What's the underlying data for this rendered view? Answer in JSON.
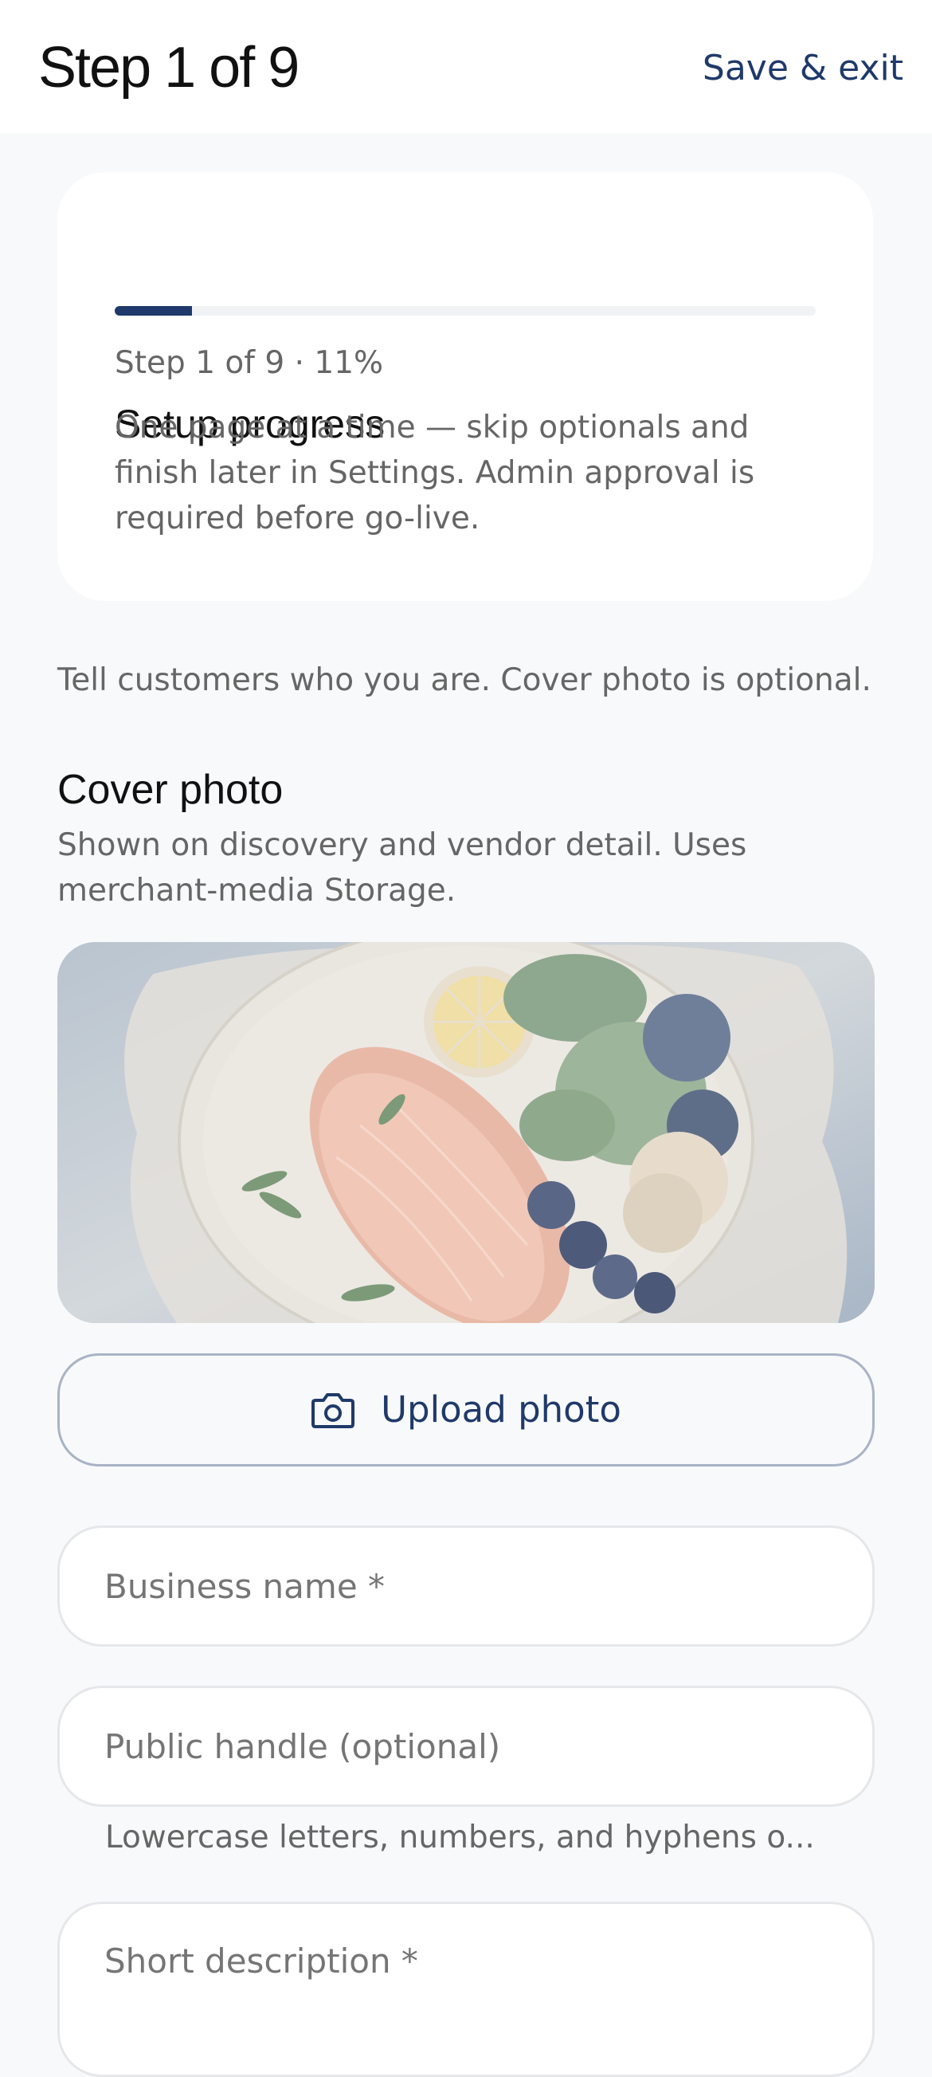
{
  "header": {
    "title": "Step 1 of 9",
    "save_exit_label": "Save & exit"
  },
  "progress": {
    "title": "Setup progress",
    "fraction": 0.11,
    "step_text": "Step 1 of 9 · 11%",
    "description": "One page at a time — skip optionals and finish later in Settings. Admin approval is required before go-live."
  },
  "intro": "Tell customers who you are. Cover photo is optional.",
  "cover_photo": {
    "title": "Cover photo",
    "description": "Shown on discovery and vendor detail. Uses merchant-media Storage.",
    "upload_label": "Upload photo",
    "upload_icon": "camera-icon"
  },
  "fields": {
    "business_name_placeholder": "Business name *",
    "handle_placeholder": "Public handle (optional)",
    "handle_helper": "Lowercase letters, numbers, and hyphens o...",
    "short_description_placeholder": "Short description *"
  },
  "colors": {
    "accent": "#1f3a6a",
    "background": "#f8f9fa",
    "card": "#ffffff",
    "muted_text": "#666666"
  }
}
